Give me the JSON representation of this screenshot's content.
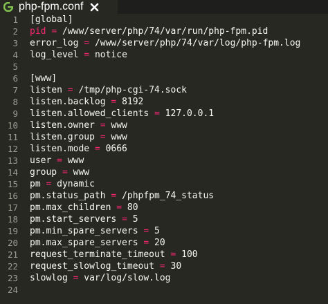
{
  "tab": {
    "label": "php-fpm.conf",
    "icon": "gear-icon",
    "close_icon": "close-icon"
  },
  "colors": {
    "background": "#272822",
    "tabbar": "#1e1f1c",
    "text": "#f8f8f2",
    "operator": "#f92672",
    "line_numbers": "#9d9d93",
    "icon": "#80c24e"
  },
  "lines": [
    {
      "n": "1",
      "key": "[global]"
    },
    {
      "n": "2",
      "key": "pid",
      "op": "=",
      "val": "/www/server/php/74/var/run/php-fpm.pid"
    },
    {
      "n": "3",
      "key": "error_log",
      "op": "=",
      "val": "/www/server/php/74/var/log/php-fpm.log"
    },
    {
      "n": "4",
      "key": "log_level",
      "op": "=",
      "val": "notice"
    },
    {
      "n": "5",
      "key": ""
    },
    {
      "n": "6",
      "key": "[www]"
    },
    {
      "n": "7",
      "key": "listen",
      "op": "=",
      "val": "/tmp/php-cgi-74.sock"
    },
    {
      "n": "8",
      "key": "listen.backlog",
      "op": "=",
      "val": "8192"
    },
    {
      "n": "9",
      "key": "listen.allowed_clients",
      "op": "=",
      "val": "127.0.0.1"
    },
    {
      "n": "10",
      "key": "listen.owner",
      "op": "=",
      "val": "www"
    },
    {
      "n": "11",
      "key": "listen.group",
      "op": "=",
      "val": "www"
    },
    {
      "n": "12",
      "key": "listen.mode",
      "op": "=",
      "val": "0666"
    },
    {
      "n": "13",
      "key": "user",
      "op": "=",
      "val": "www"
    },
    {
      "n": "14",
      "key": "group",
      "op": "=",
      "val": "www"
    },
    {
      "n": "15",
      "key": "pm",
      "op": "=",
      "val": "dynamic"
    },
    {
      "n": "16",
      "key": "pm.status_path",
      "op": "=",
      "val": "/phpfpm_74_status"
    },
    {
      "n": "17",
      "key": "pm.max_children",
      "op": "=",
      "val": "80"
    },
    {
      "n": "18",
      "key": "pm.start_servers",
      "op": "=",
      "val": "5"
    },
    {
      "n": "19",
      "key": "pm.min_spare_servers",
      "op": "=",
      "val": "5"
    },
    {
      "n": "20",
      "key": "pm.max_spare_servers",
      "op": "=",
      "val": "20"
    },
    {
      "n": "21",
      "key": "request_terminate_timeout",
      "op": "=",
      "val": "100"
    },
    {
      "n": "22",
      "key": "request_slowlog_timeout",
      "op": "=",
      "val": "30"
    },
    {
      "n": "23",
      "key": "slowlog",
      "op": "=",
      "val": "var/log/slow.log"
    },
    {
      "n": "24",
      "key": ""
    }
  ]
}
